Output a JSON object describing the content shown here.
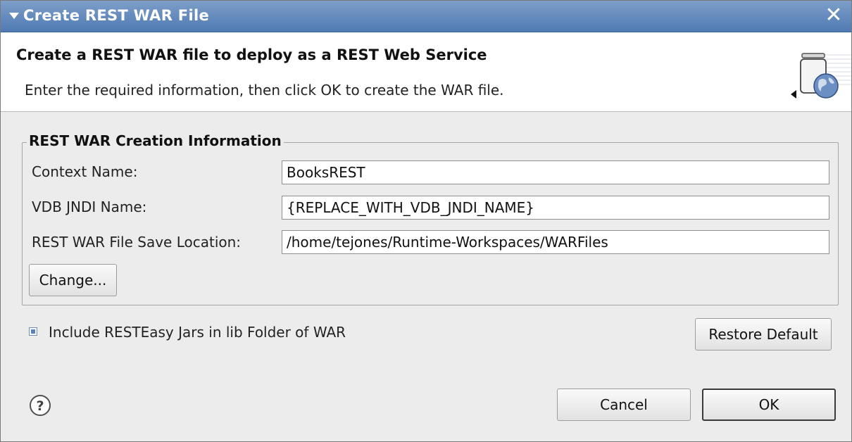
{
  "window": {
    "title": "Create REST WAR File",
    "close_glyph": "✕"
  },
  "banner": {
    "heading": "Create a REST WAR file to deploy as a REST Web Service",
    "description": "Enter the required information, then click OK to create the WAR file.",
    "icon": "war-file-globe-icon"
  },
  "group": {
    "legend": "REST WAR Creation Information",
    "fields": {
      "context_name": {
        "label": "Context Name:",
        "value": "BooksREST"
      },
      "vdb_jndi_name": {
        "label": "VDB JNDI Name:",
        "value": "{REPLACE_WITH_VDB_JNDI_NAME}"
      },
      "save_location": {
        "label": "REST WAR File Save Location:",
        "value": "/home/tejones/Runtime-Workspaces/WARFiles"
      }
    },
    "change_button": "Change..."
  },
  "options": {
    "include_jars_label": "Include RESTEasy Jars in lib Folder of WAR",
    "include_jars_checked": true,
    "restore_default_button": "Restore Default"
  },
  "footer": {
    "help_icon": "help-icon",
    "cancel_button": "Cancel",
    "ok_button": "OK"
  },
  "colors": {
    "titlebar": "#5b83b9",
    "dialog_background": "#ececec",
    "banner_background": "#ffffff",
    "accent": "#5a82c2"
  }
}
